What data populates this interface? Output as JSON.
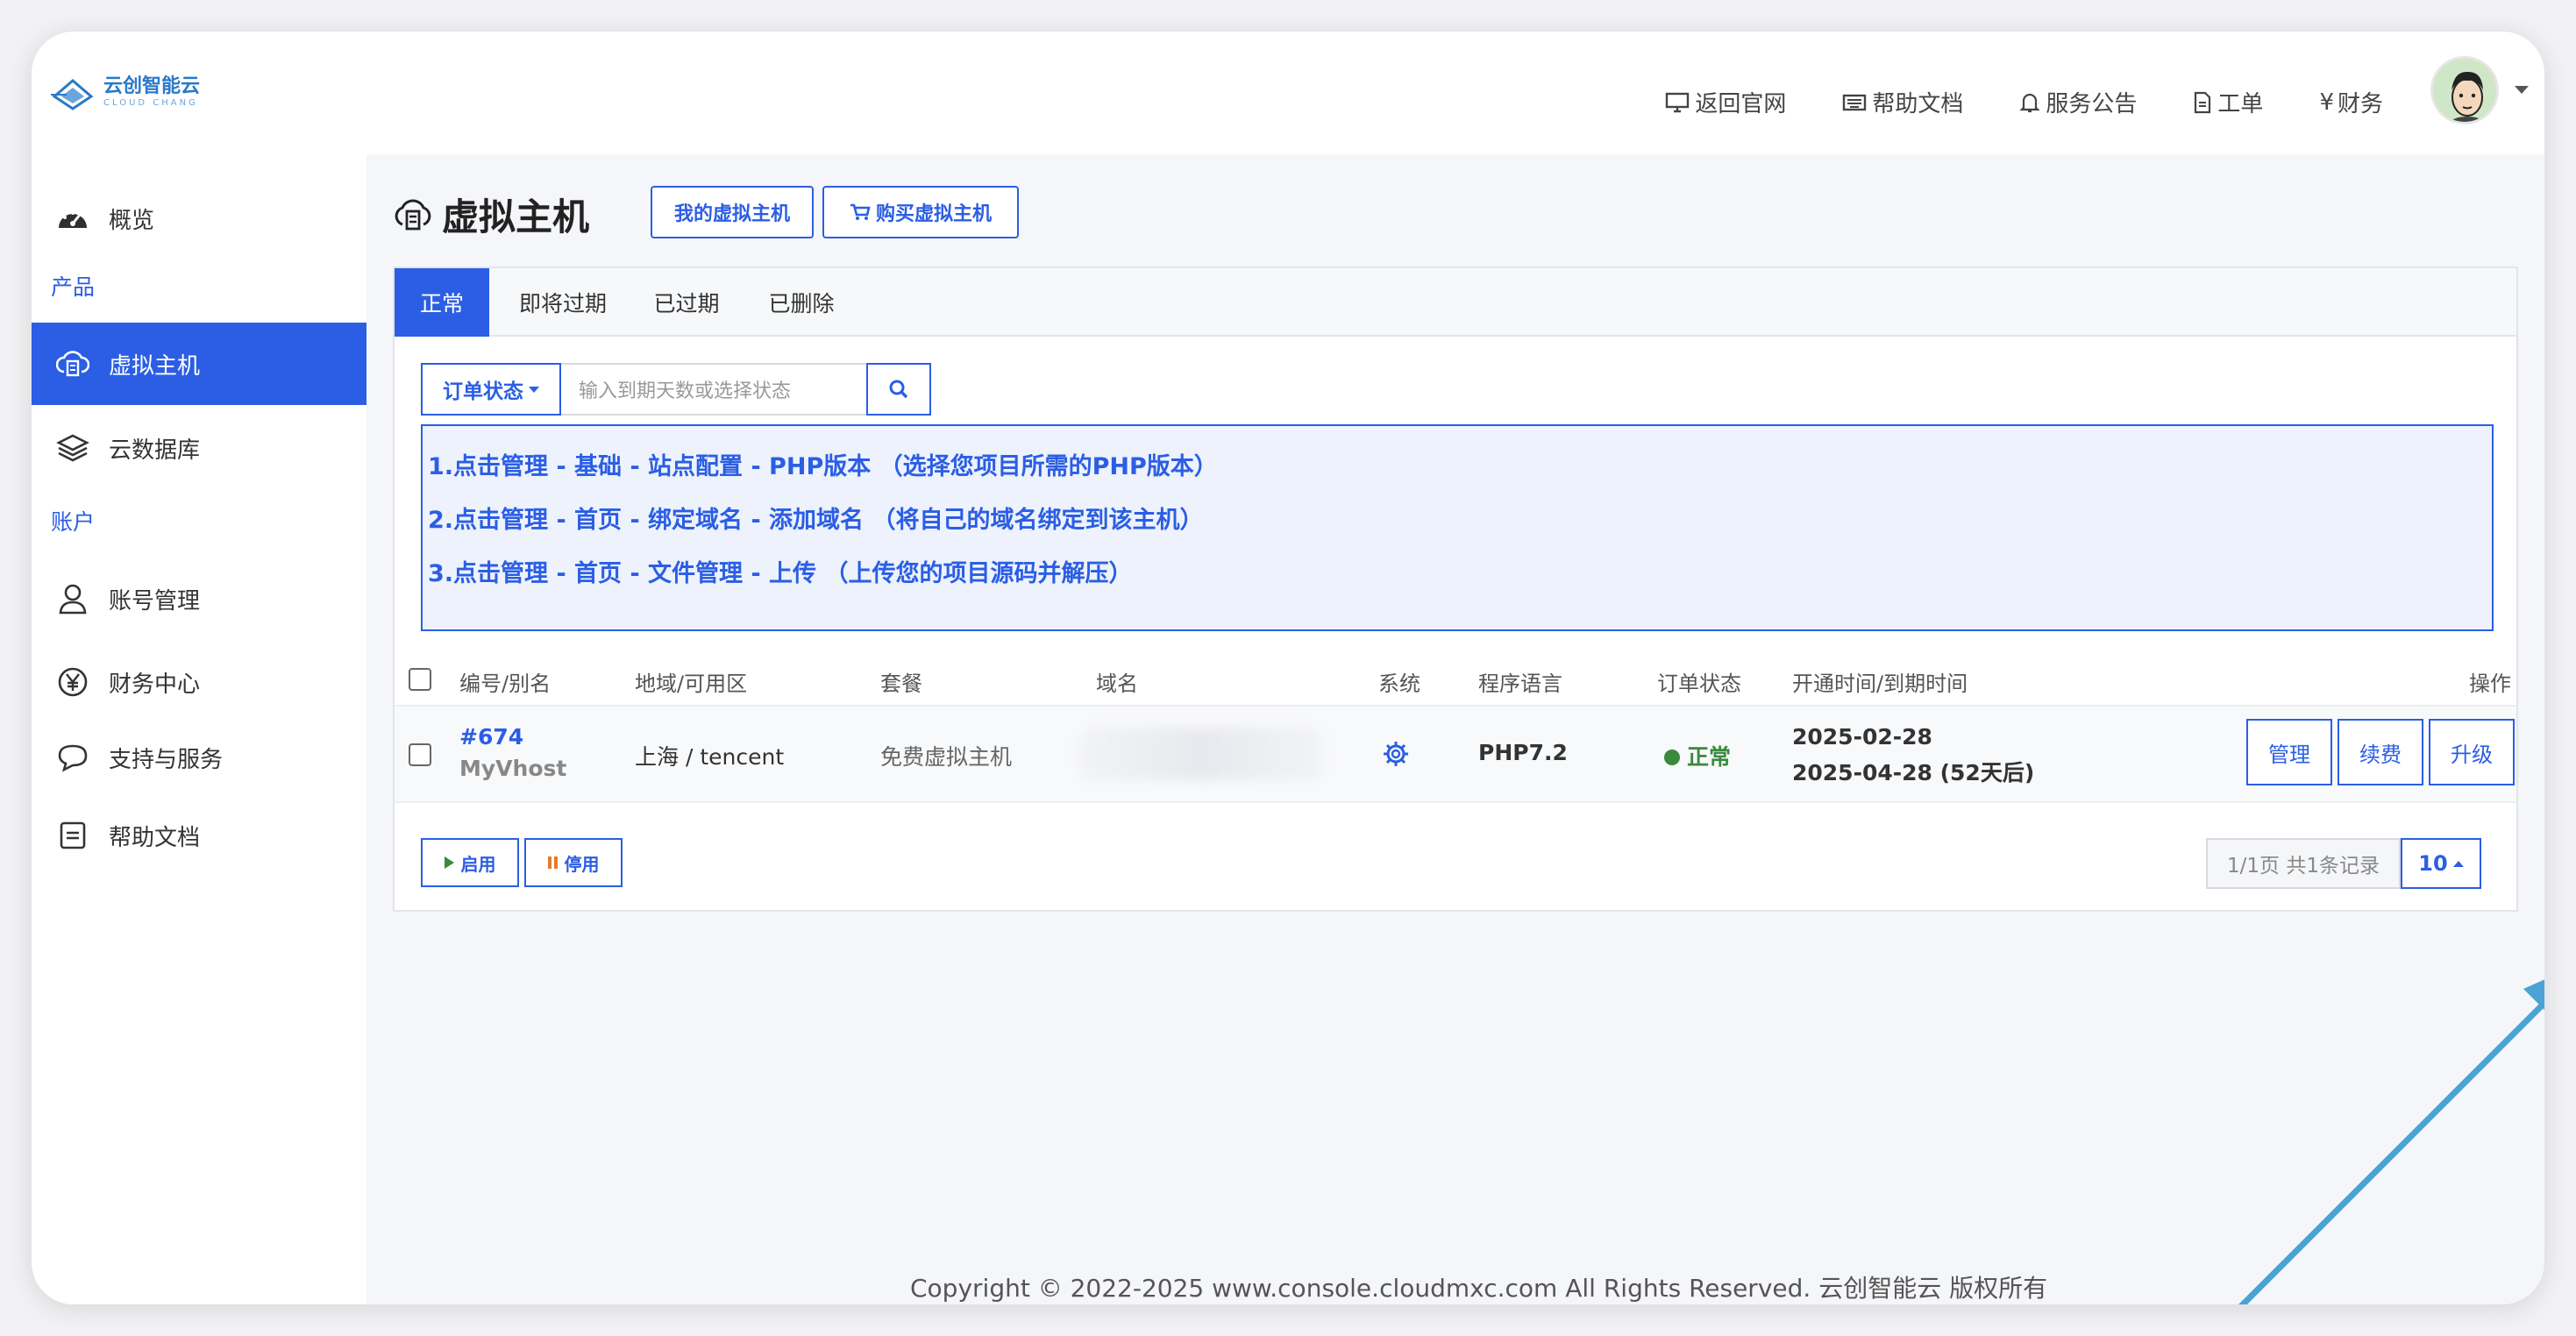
{
  "brand": {
    "name_cn": "云创智能云",
    "name_en": "CLOUD CHANG"
  },
  "topnav": [
    {
      "label": "返回官网",
      "icon": "monitor-icon"
    },
    {
      "label": "帮助文档",
      "icon": "keyboard-icon"
    },
    {
      "label": "服务公告",
      "icon": "bell-icon"
    },
    {
      "label": "工单",
      "icon": "document-icon"
    },
    {
      "label": "财务",
      "icon": "yen-icon"
    }
  ],
  "sidebar": {
    "overview": "概览",
    "group_products": "产品",
    "virtual_host": "虚拟主机",
    "cloud_db": "云数据库",
    "group_account": "账户",
    "account_mgmt": "账号管理",
    "finance": "财务中心",
    "support": "支持与服务",
    "help": "帮助文档"
  },
  "page": {
    "title": "虚拟主机",
    "my_hosts_btn": "我的虚拟主机",
    "buy_btn": "购买虚拟主机"
  },
  "tabs": [
    "正常",
    "即将过期",
    "已过期",
    "已删除"
  ],
  "filter": {
    "status_label": "订单状态",
    "placeholder": "输入到期天数或选择状态"
  },
  "notice": [
    "1.点击管理 - 基础 - 站点配置 - PHP版本 （选择您项目所需的PHP版本）",
    "2.点击管理 - 首页 - 绑定域名 - 添加域名 （将自己的域名绑定到该主机）",
    "3.点击管理 - 首页 - 文件管理 - 上传 （上传您的项目源码并解压）"
  ],
  "table": {
    "headers": {
      "id": "编号/别名",
      "region": "地域/可用区",
      "plan": "套餐",
      "domain": "域名",
      "system": "系统",
      "lang": "程序语言",
      "status": "订单状态",
      "time": "开通时间/到期时间",
      "ops": "操作"
    },
    "row": {
      "id": "#674",
      "alias": "MyVhost",
      "region": "上海 / tencent",
      "plan": "免费虚拟主机",
      "lang": "PHP7.2",
      "status": "正常",
      "open_time": "2025-02-28",
      "expire_time": "2025-04-28 (52天后)",
      "btn_manage": "管理",
      "btn_renew": "续费",
      "btn_upgrade": "升级"
    }
  },
  "footer_actions": {
    "enable": "启用",
    "disable": "停用"
  },
  "pager": {
    "info": "1/1页 共1条记录",
    "size": "10"
  },
  "copyright": "Copyright © 2022-2025 www.console.cloudmxc.com All Rights Reserved. 云创智能云 版权所有",
  "colors": {
    "primary": "#2b5ee4",
    "status_ok": "#3a8a3e",
    "arrow": "#4aa3d4"
  }
}
